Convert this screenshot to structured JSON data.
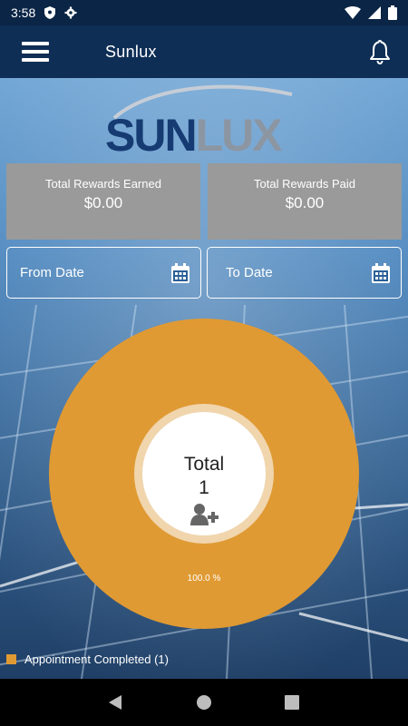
{
  "status_bar": {
    "time": "3:58"
  },
  "app_bar": {
    "title": "Sunlux"
  },
  "logo": {
    "text": "SUNLUX"
  },
  "cards": {
    "earned": {
      "label": "Total Rewards Earned",
      "value": "$0.00"
    },
    "paid": {
      "label": "Total Rewards Paid",
      "value": "$0.00"
    }
  },
  "filters": {
    "from": {
      "label": "From Date"
    },
    "to": {
      "label": "To Date"
    }
  },
  "chart_data": {
    "type": "pie",
    "categories": [
      "Appointment Completed"
    ],
    "values": [
      1
    ],
    "slice_labels": [
      "100.0 %"
    ],
    "center_title": "Total",
    "center_value": "1",
    "colors": [
      "#e09a33"
    ]
  },
  "legend": {
    "items": [
      {
        "label": "Appointment Completed (1)",
        "color": "#e09a33"
      }
    ]
  },
  "icons": {
    "menu": "hamburger-icon",
    "notifications": "bell-icon",
    "calendar": "calendar-icon",
    "add_user": "add-user-icon"
  }
}
